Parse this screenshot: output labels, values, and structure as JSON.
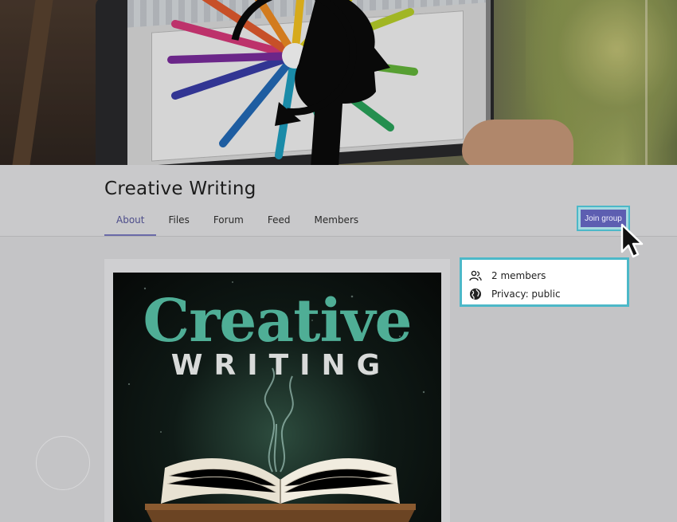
{
  "group": {
    "title": "Creative Writing",
    "join_label": "Join group"
  },
  "tabs": [
    {
      "label": "About",
      "active": true
    },
    {
      "label": "Files",
      "active": false
    },
    {
      "label": "Forum",
      "active": false
    },
    {
      "label": "Feed",
      "active": false
    },
    {
      "label": "Members",
      "active": false
    }
  ],
  "info": {
    "members_text": "2 members",
    "privacy_text": "Privacy: public",
    "members_icon": "people-icon",
    "privacy_icon": "globe-icon"
  },
  "cover": {
    "title": "Creative",
    "subtitle": "WRITING"
  },
  "colors": {
    "accent": "#5d5eb1",
    "highlight": "#4cb8c8",
    "cover_title": "#4fae96"
  }
}
